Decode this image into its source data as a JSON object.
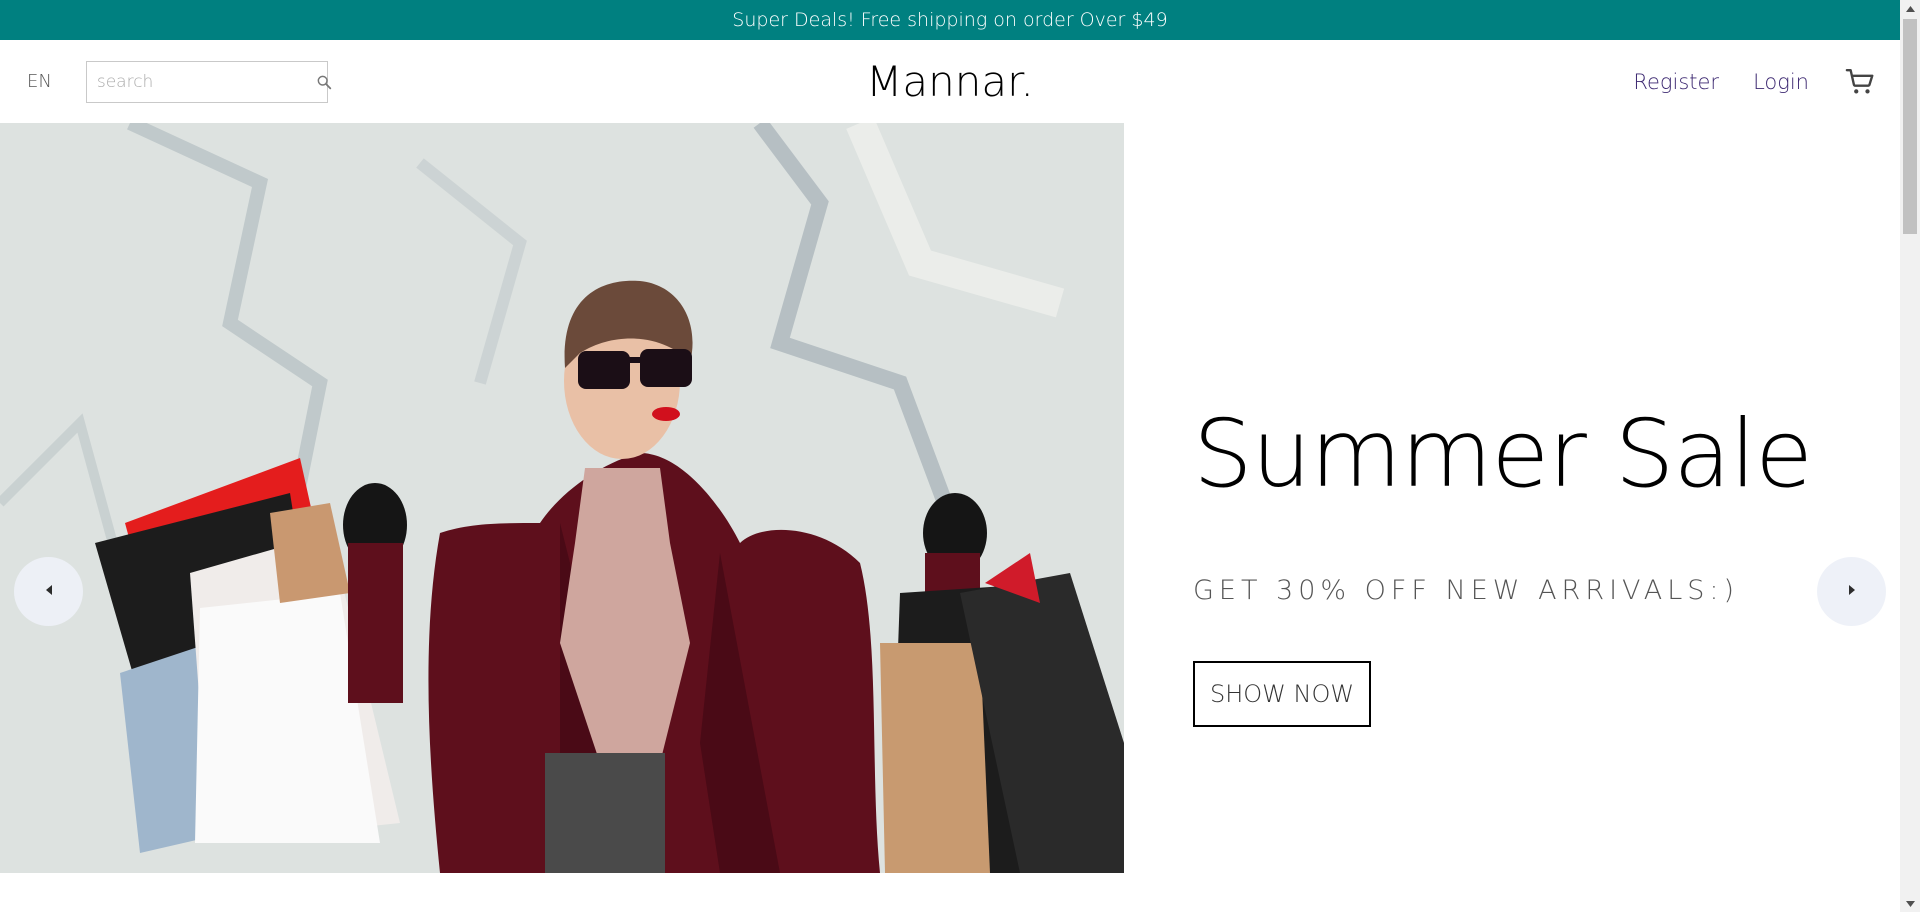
{
  "announcement": {
    "text": "Super Deals! Free shipping on order Over $49"
  },
  "navbar": {
    "language": "EN",
    "search": {
      "placeholder": "search",
      "value": ""
    },
    "logo": "Mannar.",
    "links": {
      "register": "Register",
      "login": "Login"
    },
    "cart_icon": "shopping-cart-icon"
  },
  "slider": {
    "current_slide": {
      "title": "Summer Sale",
      "description": "GET 30% OFF NEW ARRIVALS:)",
      "button_label": "SHOW NOW"
    },
    "left_arrow_icon": "arrow-left-icon",
    "right_arrow_icon": "arrow-right-icon"
  },
  "colors": {
    "announcement_bg": "#008080",
    "nav_link": "#3e2a72",
    "arrow_bg": "#eef1f8"
  }
}
